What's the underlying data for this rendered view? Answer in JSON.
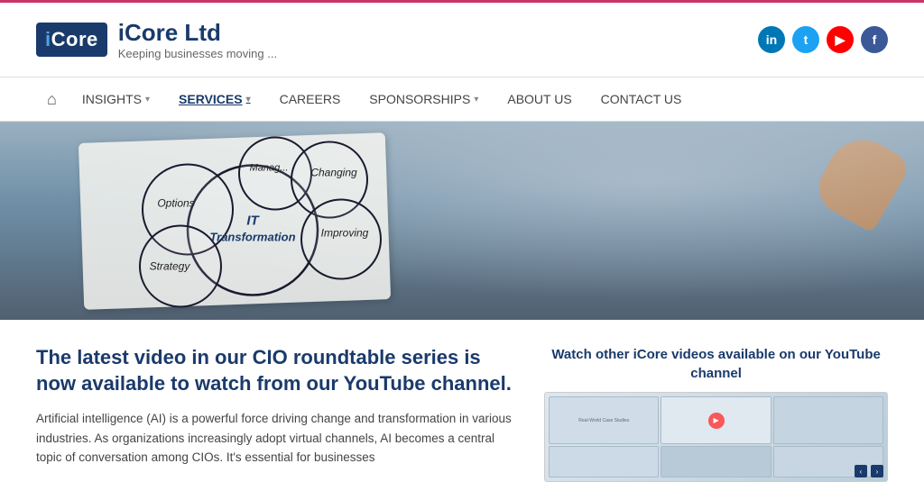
{
  "topbar": {},
  "header": {
    "logo_box": "iCore",
    "logo_box_highlight": "i",
    "logo_title": "iCore Ltd",
    "logo_subtitle": "Keeping businesses moving ...",
    "social": [
      {
        "name": "linkedin",
        "label": "in",
        "class": "si-linkedin"
      },
      {
        "name": "twitter",
        "label": "t",
        "class": "si-twitter"
      },
      {
        "name": "youtube",
        "label": "▶",
        "class": "si-youtube"
      },
      {
        "name": "facebook",
        "label": "f",
        "class": "si-facebook"
      }
    ]
  },
  "nav": {
    "home_icon": "⌂",
    "items": [
      {
        "label": "INSIGHTS",
        "arrow": true,
        "active": false
      },
      {
        "label": "SERVICES",
        "arrow": true,
        "active": true
      },
      {
        "label": "CAREERS",
        "arrow": false,
        "active": false
      },
      {
        "label": "SPONSORSHIPS",
        "arrow": true,
        "active": false
      },
      {
        "label": "ABOUT US",
        "arrow": false,
        "active": false
      },
      {
        "label": "CONTACT US",
        "arrow": false,
        "active": false
      }
    ]
  },
  "hero": {
    "alt": "IT Transformation diagram on paper"
  },
  "content": {
    "heading": "The latest video in our CIO roundtable series is now available to watch from our YouTube channel.",
    "body": "Artificial intelligence (AI) is a powerful force driving change and transformation in various industries. As organizations increasingly adopt virtual channels, AI becomes a central topic of conversation among CIOs. It's essential for businesses",
    "sidebar_heading": "Watch other iCore videos available on our YouTube channel"
  }
}
